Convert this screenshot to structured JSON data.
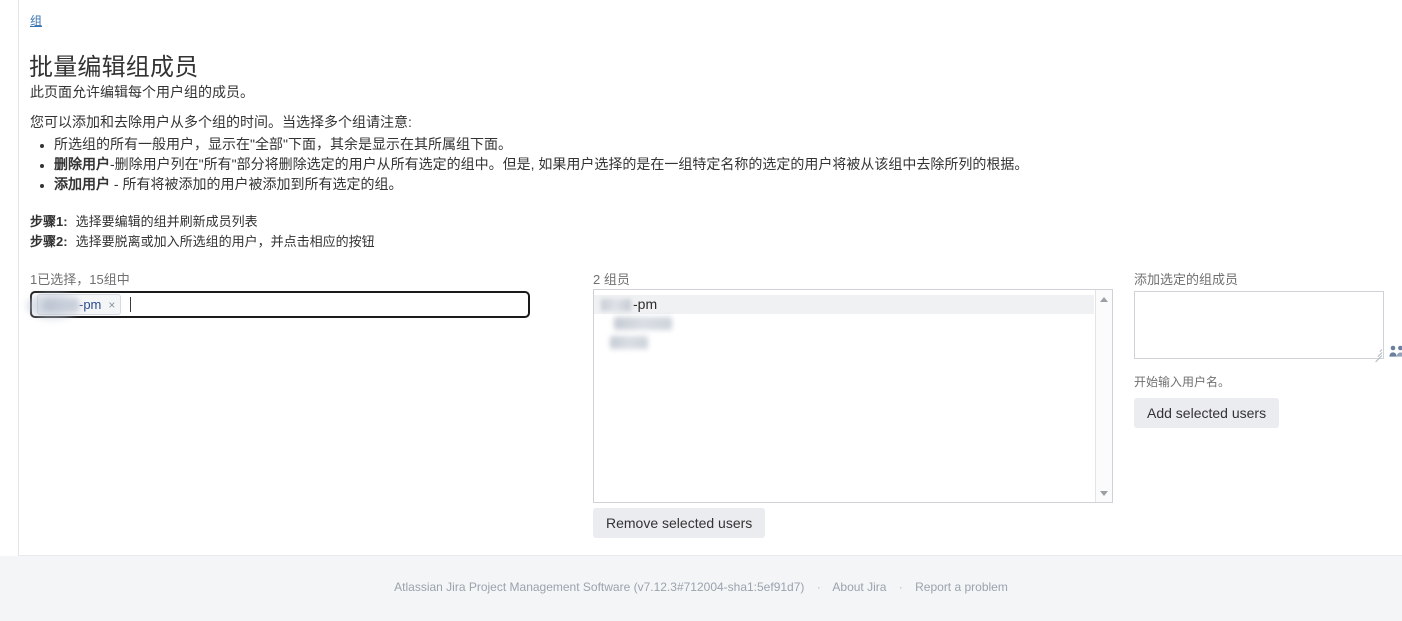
{
  "breadcrumb": {
    "label": "组"
  },
  "page_title": "批量编辑组成员",
  "intro": {
    "paragraph_1": "此页面允许编辑每个用户组的成员。",
    "paragraph_2": "您可以添加和去除用户从多个组的时间。当选择多个组请注意:"
  },
  "notes": [
    {
      "bold": "",
      "text": "所选组的所有一般用户，显示在\"全部\"下面，其余是显示在其所属组下面。"
    },
    {
      "bold": "删除用户",
      "text": "-删除用户列在\"所有\"部分将删除选定的用户从所有选定的组中。但是, 如果用户选择的是在一组特定名称的选定的用户将被从该组中去除所列的根据。"
    },
    {
      "bold": "添加用户",
      "text": " - 所有将被添加的用户被添加到所有选定的组。"
    }
  ],
  "steps": [
    {
      "label": "步骤1:",
      "text": "选择要编辑的组并刷新成员列表"
    },
    {
      "label": "步骤2:",
      "text": "选择要脱离或加入所选组的用户，并点击相应的按钮"
    }
  ],
  "groups_field": {
    "label": "1已选择，15组中",
    "selected_chips": [
      {
        "redacted_prefix": true,
        "text": "-pm",
        "remove_label": "×"
      }
    ]
  },
  "members_panel": {
    "label": "2 组员",
    "optgroup": {
      "redacted_prefix": true,
      "text": "-pm"
    },
    "options": [
      {
        "redacted": true,
        "text": ""
      },
      {
        "redacted": true,
        "text": ""
      }
    ],
    "scrollbar": {
      "up_icon": "caret-up-icon",
      "down_icon": "caret-down-icon"
    },
    "remove_button": "Remove selected users"
  },
  "add_panel": {
    "label": "添加选定的组成员",
    "textarea_value": "",
    "textarea_placeholder": "",
    "picker_icon": "user-group-picker-icon",
    "hint": "开始输入用户名。",
    "add_button": "Add selected users"
  },
  "footer": {
    "product": "Atlassian Jira Project Management Software (v7.12.3#712004-sha1:5ef91d7)",
    "separator": "·",
    "about_link": "About Jira",
    "report_link": "Report a problem"
  },
  "colors": {
    "link": "#3572b0",
    "text": "#333333",
    "muted": "#707070",
    "button_bg": "#ebecf0",
    "footer_bg": "#f4f5f7",
    "border": "#cfd3d9"
  }
}
